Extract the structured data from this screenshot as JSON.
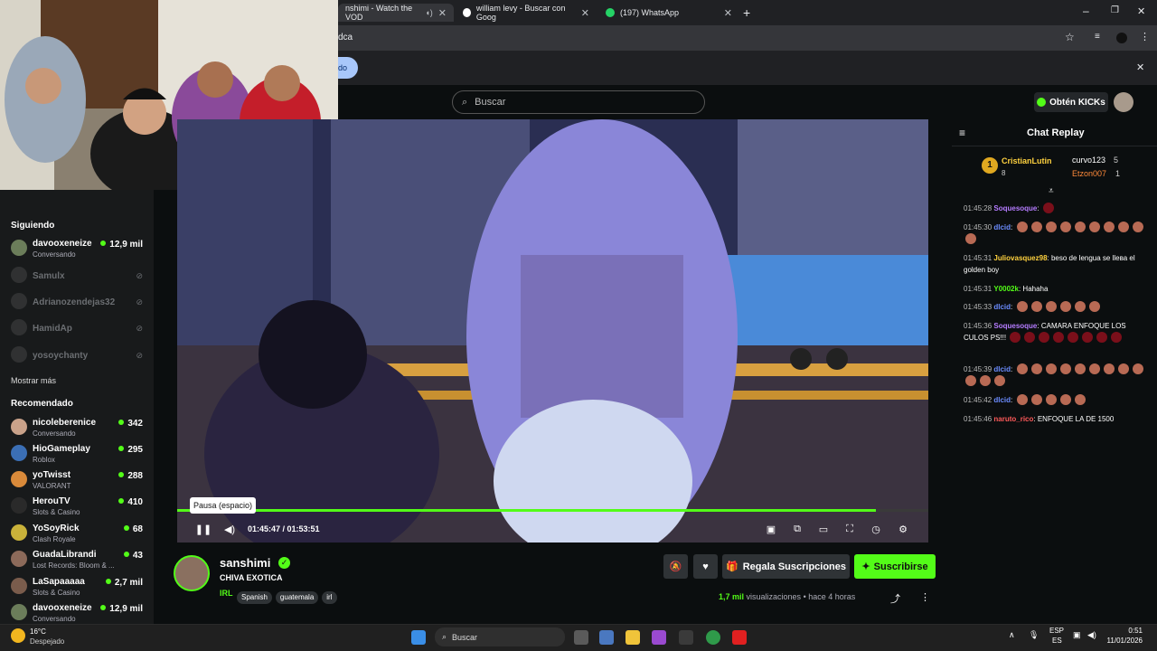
{
  "browser": {
    "tabs": [
      {
        "label": "nshimi - Watch the VOD",
        "active": true
      },
      {
        "label": "william levy - Buscar con Goog",
        "active": false
      },
      {
        "label": "(197) WhatsApp",
        "active": false
      }
    ],
    "url": "dca",
    "infobar_button": "do"
  },
  "header": {
    "search_placeholder": "Buscar",
    "kicks_button": "Obtén KICKs"
  },
  "sidebar": {
    "following_title": "Siguiendo",
    "following": [
      {
        "name": "davooxeneize",
        "sub": "Conversando",
        "viewers": "12,9 mil",
        "live": true
      },
      {
        "name": "Samulx",
        "live": false
      },
      {
        "name": "Adrianozendejas32",
        "live": false
      },
      {
        "name": "HamidAp",
        "live": false
      },
      {
        "name": "yosoychanty",
        "live": false
      }
    ],
    "show_more": "Mostrar más",
    "recommended_title": "Recomendado",
    "recommended": [
      {
        "name": "nicoleberenice",
        "sub": "Conversando",
        "viewers": "342"
      },
      {
        "name": "HioGameplay",
        "sub": "Roblox",
        "viewers": "295"
      },
      {
        "name": "yoTwisst",
        "sub": "VALORANT",
        "viewers": "288"
      },
      {
        "name": "HerouTV",
        "sub": "Slots & Casino",
        "viewers": "410"
      },
      {
        "name": "YoSoyRick",
        "sub": "Clash Royale",
        "viewers": "68"
      },
      {
        "name": "GuadaLibrandi",
        "sub": "Lost Records: Bloom & ...",
        "viewers": "43"
      },
      {
        "name": "LaSapaaaaa",
        "sub": "Slots & Casino",
        "viewers": "2,7 mil"
      },
      {
        "name": "davooxeneize",
        "sub": "Conversando",
        "viewers": "12,9 mil"
      }
    ]
  },
  "player": {
    "tooltip": "Pausa (espacio)",
    "time": "01:45:47 / 01:53:51",
    "progress": 0.93
  },
  "chat": {
    "title": "Chat Replay",
    "top_gifters": [
      {
        "rank": "1",
        "name": "CristianLutin",
        "count": "8"
      },
      {
        "name": "curvo123",
        "count": "5"
      },
      {
        "name": "Etzon007",
        "count": "1"
      }
    ],
    "messages": [
      {
        "time": "01:45:28",
        "user": "Soquesoque",
        "color": "#b57cff",
        "text": "",
        "emotes": 1
      },
      {
        "time": "01:45:30",
        "user": "dlcid",
        "color": "#6b8cff",
        "text": "",
        "emotes": 10
      },
      {
        "time": "01:45:31",
        "user": "Juliovasquez98",
        "color": "#ffd23f",
        "text": "beso de lengua se llева el golden boy",
        "emotes": 0
      },
      {
        "time": "01:45:31",
        "user": "Y0002k",
        "color": "#53fc18",
        "text": "Hahaha",
        "emotes": 0
      },
      {
        "time": "01:45:33",
        "user": "dlcid",
        "color": "#6b8cff",
        "text": "",
        "emotes": 6
      },
      {
        "time": "01:45:36",
        "user": "Soquesoque",
        "color": "#b57cff",
        "text": "CAMARA ENFOQUE LOS CULOS PS!!!",
        "emotes": 8
      },
      {
        "time": "01:45:39",
        "user": "dlcid",
        "color": "#6b8cff",
        "text": "",
        "emotes": 12
      },
      {
        "time": "01:45:42",
        "user": "dlcid",
        "color": "#6b8cff",
        "text": "",
        "emotes": 5
      },
      {
        "time": "01:45:46",
        "user": "naruto_rico",
        "color": "#ff5a5a",
        "text": "ENFOQUE LA DE 1500",
        "emotes": 0
      }
    ]
  },
  "stream": {
    "channel": "sanshimi",
    "title": "CHIVA EXOTICA",
    "category": "IRL",
    "tags": [
      "Spanish",
      "guatemala",
      "irl"
    ],
    "gift_button": "Regala Suscripciones",
    "subscribe_button": "Suscribirse",
    "views_count": "1,7 mil",
    "views_label": "visualizaciones",
    "ago": "hace 4 horas"
  },
  "taskbar": {
    "weather_temp": "16°C",
    "weather_desc": "Despejado",
    "search": "Buscar",
    "lang1": "ESP",
    "lang2": "ES",
    "time": "0:51",
    "date": "11/01/2026"
  },
  "colors": {
    "accent": "#53fc18",
    "bg": "#0b0e0f"
  }
}
